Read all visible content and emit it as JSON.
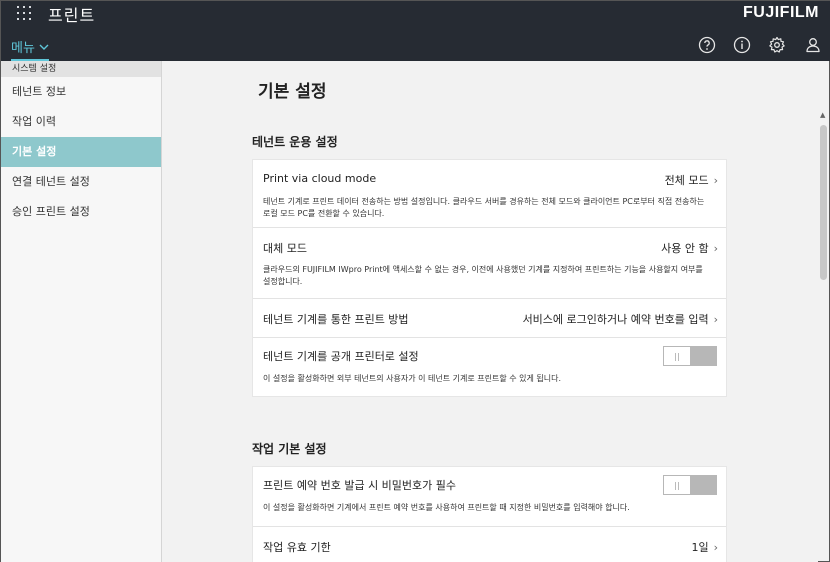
{
  "header": {
    "app_title": "프린트",
    "brand": "FUJIFILM",
    "menu_label": "메뉴",
    "icons": [
      "help-icon",
      "info-icon",
      "gear-icon",
      "user-icon"
    ]
  },
  "sidebar": {
    "section_header": "시스템 설정",
    "items": [
      {
        "label": "테넌트 정보",
        "active": false
      },
      {
        "label": "작업 이력",
        "active": false
      },
      {
        "label": "기본 설정",
        "active": true
      },
      {
        "label": "연결 테넌트 설정",
        "active": false
      },
      {
        "label": "승인 프린트 설정",
        "active": false
      }
    ]
  },
  "main": {
    "page_title": "기본 설정",
    "sections": [
      {
        "title": "테넌트 운용 설정",
        "rows": [
          {
            "label": "Print via cloud mode",
            "value": "전체 모드",
            "desc": "테넌트 기계로 프린트 데이터 전송하는 방법 설정입니다. 클라우드 서버를 경유하는 전체 모드와 클라이언트 PC로부터 직접 전송하는 로컬 모드 PC를 전환할 수 있습니다."
          },
          {
            "label": "대체 모드",
            "value": "사용 안 함",
            "desc": "클라우드의 FUJIFILM IWpro Print에 액세스할 수 없는 경우, 이전에 사용했던 기계를 지정하여 프린트하는 기능을 사용할지 여부를 설정합니다."
          },
          {
            "label": "테넌트 기계를 통한 프린트 방법",
            "value": "서비스에 로그인하거나 예약 번호를 입력"
          },
          {
            "label": "테넌트 기계를 공개 프린터로 설정",
            "toggle": "off",
            "desc": "이 설정을 활성화하면 외부 테넌트의 사용자가 이 테넌트 기계로 프린트할 수 있게 됩니다."
          }
        ]
      },
      {
        "title": "작업 기본 설정",
        "rows": [
          {
            "label": "프린트 예약 번호 발급 시 비밀번호가 필수",
            "toggle": "off",
            "desc": "이 설정을 활성화하면 기계에서 프린트 예약 번호를 사용하여 프린트할 때 지정한 비밀번호를 입력해야 합니다."
          },
          {
            "label": "작업 유효 기한",
            "value": "1일"
          }
        ]
      }
    ]
  }
}
